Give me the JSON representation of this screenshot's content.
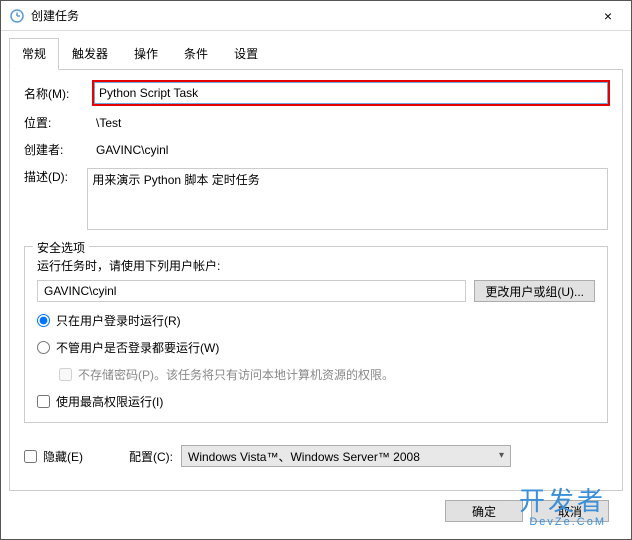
{
  "window": {
    "title": "创建任务",
    "close_icon": "×"
  },
  "tabs": [
    "常规",
    "触发器",
    "操作",
    "条件",
    "设置"
  ],
  "fields": {
    "name_label": "名称(M):",
    "name_value": "Python Script Task",
    "location_label": "位置:",
    "location_value": "\\Test",
    "creator_label": "创建者:",
    "creator_value": "GAVINC\\cyinl",
    "desc_label": "描述(D):",
    "desc_value": "用来演示 Python 脚本 定时任务"
  },
  "security": {
    "legend": "安全选项",
    "prompt": "运行任务时，请使用下列用户帐户:",
    "account": "GAVINC\\cyinl",
    "change_user_btn": "更改用户或组(U)...",
    "radio_logged_on": "只在用户登录时运行(R)",
    "radio_any": "不管用户是否登录都要运行(W)",
    "no_store_pw": "不存储密码(P)。该任务将只有访问本地计算机资源的权限。",
    "highest_priv": "使用最高权限运行(I)"
  },
  "bottom": {
    "hidden_label": "隐藏(E)",
    "config_label": "配置(C):",
    "config_value": "Windows Vista™、Windows Server™ 2008"
  },
  "footer": {
    "ok": "确定",
    "cancel": "取消"
  },
  "watermark": {
    "main": "开发者",
    "sub": "DevZe.CoM"
  }
}
